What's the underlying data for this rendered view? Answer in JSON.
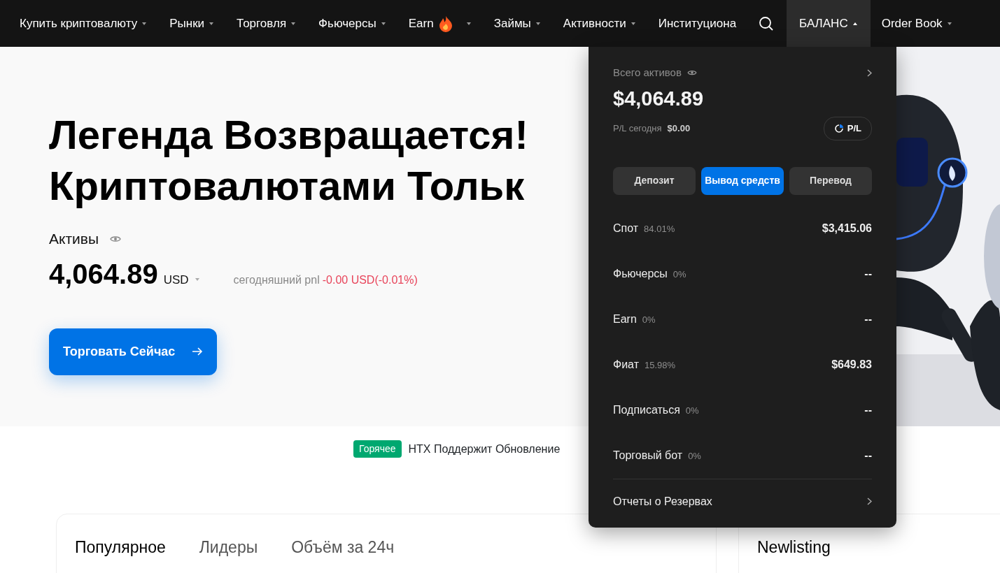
{
  "nav": {
    "left_items": [
      {
        "label": "Купить криптовалюту",
        "kind": "menu",
        "expanded": false
      },
      {
        "label": "Рынки",
        "kind": "menu",
        "expanded": false
      },
      {
        "label": "Торговля",
        "kind": "menu",
        "expanded": false
      },
      {
        "label": "Фьючерсы",
        "kind": "menu",
        "expanded": false
      },
      {
        "label": "Earn",
        "kind": "hot",
        "expanded": false
      },
      {
        "label": "Займы",
        "kind": "menu",
        "expanded": false
      },
      {
        "label": "Активности",
        "kind": "menu",
        "expanded": false
      },
      {
        "label": "Институциона",
        "kind": "plain",
        "expanded": false
      }
    ],
    "right_items": [
      {
        "label": "БАЛАНС",
        "kind": "menu",
        "expanded": true
      },
      {
        "label": "Order Book",
        "kind": "menu",
        "expanded": false
      }
    ]
  },
  "hero": {
    "headline": [
      "Легенда Возвращается!",
      "Криптовалютами Тольк"
    ],
    "assets_label": "Активы",
    "amount": "4,064.89",
    "currency": "USD",
    "pnl_label": "сегодняшний pnl",
    "pnl_value": "-0.00 USD(-0.01%)",
    "cta": "Торговать Сейчас",
    "image": {
      "kind": "picture"
    }
  },
  "ticker": {
    "badge": "Горячее",
    "text": "HTX Поддержит Обновление"
  },
  "balance_menu": {
    "title": "Всего активов",
    "total": "$4,064.89",
    "pl_label": "P/L сегодня",
    "pl_value": "$0.00",
    "pl_button": "P/L",
    "actions": [
      {
        "label": "Депозит",
        "selected": false
      },
      {
        "label": "Вывод средств",
        "selected": true
      },
      {
        "label": "Перевод",
        "selected": false
      }
    ],
    "accounts": [
      {
        "name": "Спот",
        "share": "84.01%",
        "value": "$3,415.06"
      },
      {
        "name": "Фьючерсы",
        "share": "0%",
        "value": "--"
      },
      {
        "name": "Earn",
        "share": "0%",
        "value": "--"
      },
      {
        "name": "Фиат",
        "share": "15.98%",
        "value": "$649.83"
      },
      {
        "name": "Подписаться",
        "share": "0%",
        "value": "--"
      },
      {
        "name": "Торговый бот",
        "share": "0%",
        "value": "--"
      }
    ],
    "footer": "Отчеты о Резервах"
  },
  "market_tabs": [
    {
      "label": "Популярное",
      "selected": true
    },
    {
      "label": "Лидеры",
      "selected": false
    },
    {
      "label": "Объём за 24ч",
      "selected": false
    }
  ],
  "side_card": {
    "title": "Newlisting"
  }
}
